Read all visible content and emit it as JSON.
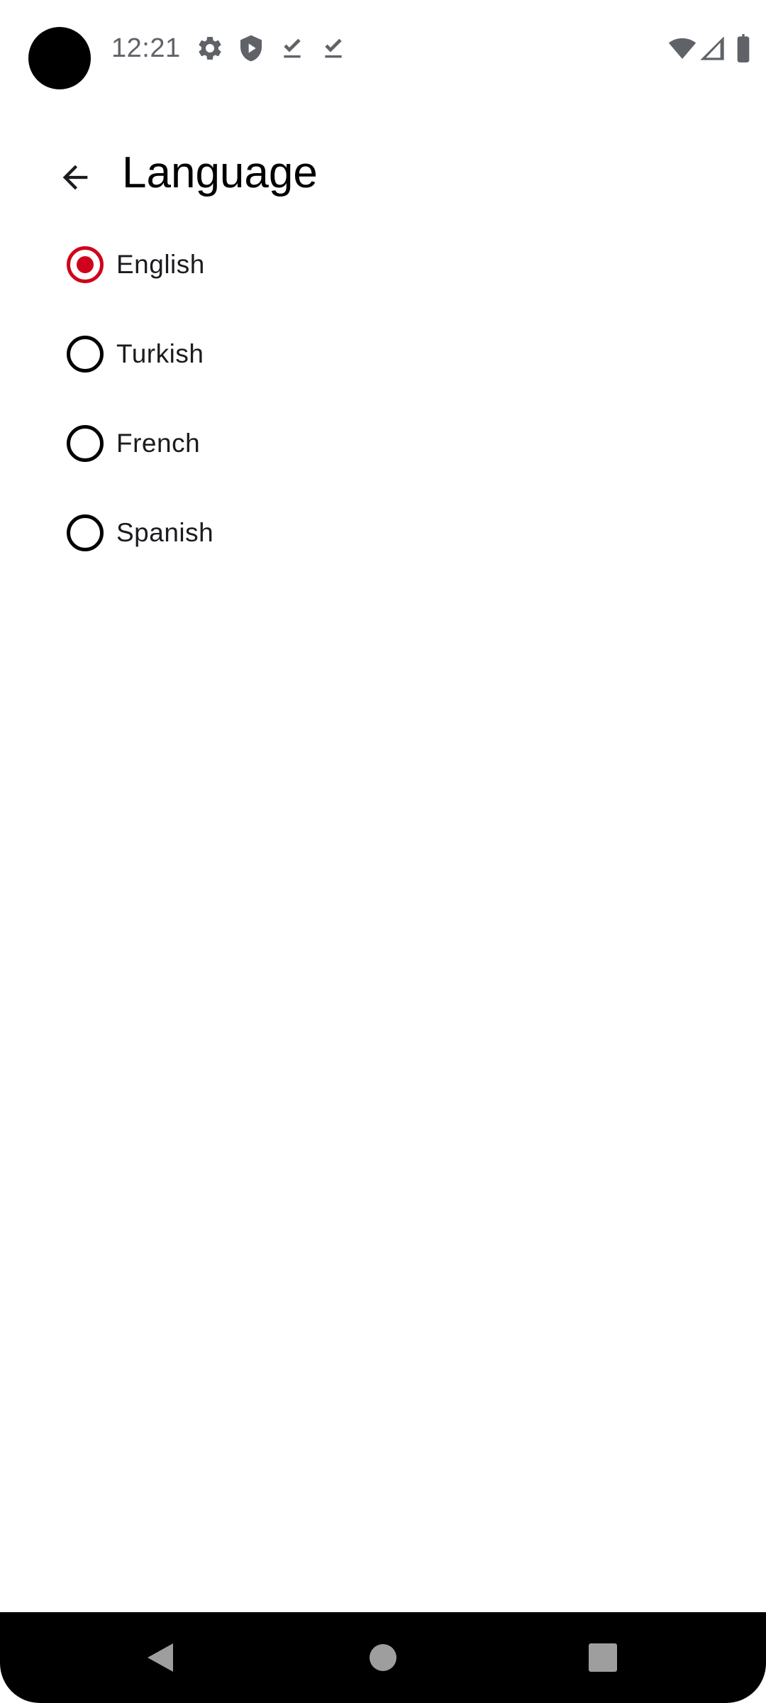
{
  "status_bar": {
    "time": "12:21",
    "notification_icons": [
      "settings-icon",
      "shield-play-icon",
      "download-done-icon",
      "download-done-icon"
    ],
    "system_icons": [
      "wifi-icon",
      "cellular-signal-icon",
      "battery-icon"
    ]
  },
  "app_bar": {
    "title": "Language",
    "back_icon": "arrow-back-icon"
  },
  "languages": {
    "selected": "English",
    "accent_color": "#d0021b",
    "options": [
      {
        "label": "English",
        "checked": true
      },
      {
        "label": "Turkish",
        "checked": false
      },
      {
        "label": "French",
        "checked": false
      },
      {
        "label": "Spanish",
        "checked": false
      }
    ]
  },
  "nav_bar": {
    "buttons": [
      "back-triangle-icon",
      "home-circle-icon",
      "recents-square-icon"
    ]
  }
}
